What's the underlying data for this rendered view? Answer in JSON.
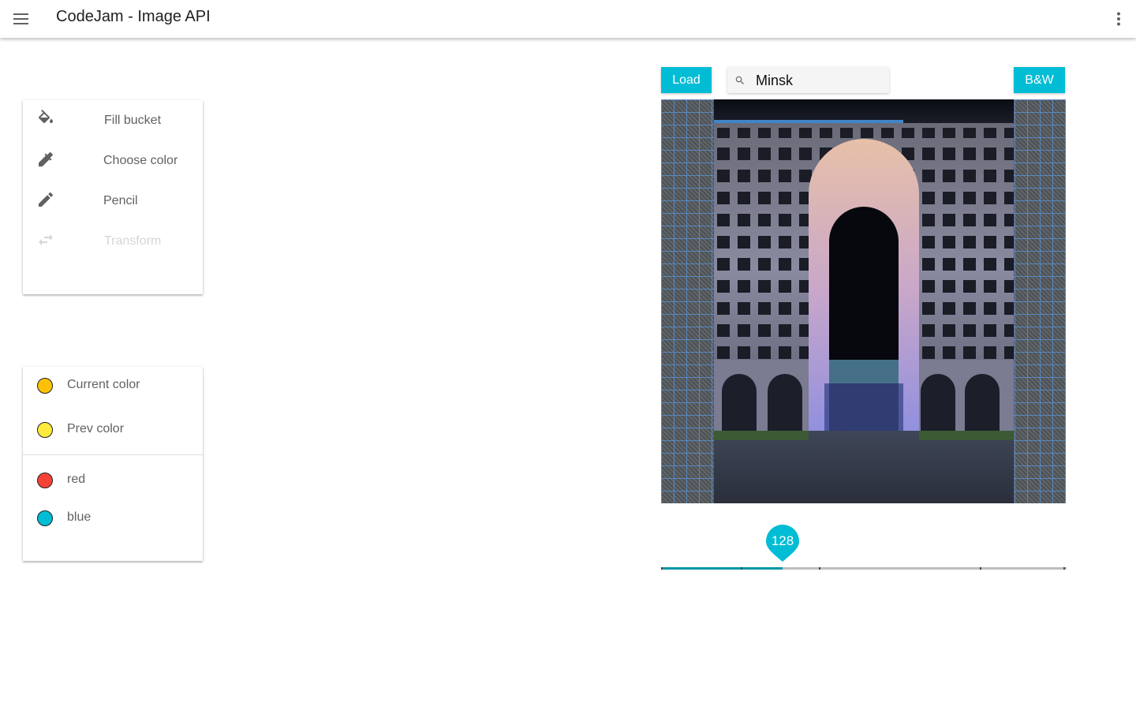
{
  "appbar": {
    "title": "CodeJam - Image API",
    "menu_icon": "hamburger-menu-icon",
    "more_icon": "more-vert-icon"
  },
  "tools": [
    {
      "label": "Fill bucket",
      "icon": "fill-bucket-icon",
      "enabled": true
    },
    {
      "label": "Choose color",
      "icon": "eyedropper-icon",
      "enabled": true
    },
    {
      "label": "Pencil",
      "icon": "pencil-icon",
      "enabled": true
    },
    {
      "label": "Transform",
      "icon": "swap-horiz-icon",
      "enabled": false
    }
  ],
  "colors": {
    "current": {
      "label": "Current color",
      "hex": "#ffc107"
    },
    "prev": {
      "label": "Prev color",
      "hex": "#ffeb3b"
    },
    "presets": [
      {
        "label": "red",
        "hex": "#f44336"
      },
      {
        "label": "blue",
        "hex": "#00bcd4"
      }
    ]
  },
  "toolbar": {
    "load_label": "Load",
    "bw_label": "B&W",
    "search_value": "Minsk",
    "search_icon": "search-icon"
  },
  "slider": {
    "value": "128",
    "min": 0,
    "max": 512,
    "steps": [
      0,
      128,
      256,
      384,
      512
    ]
  },
  "theme": {
    "accent": "#00bcd4",
    "accent_dark": "#0097a7"
  }
}
